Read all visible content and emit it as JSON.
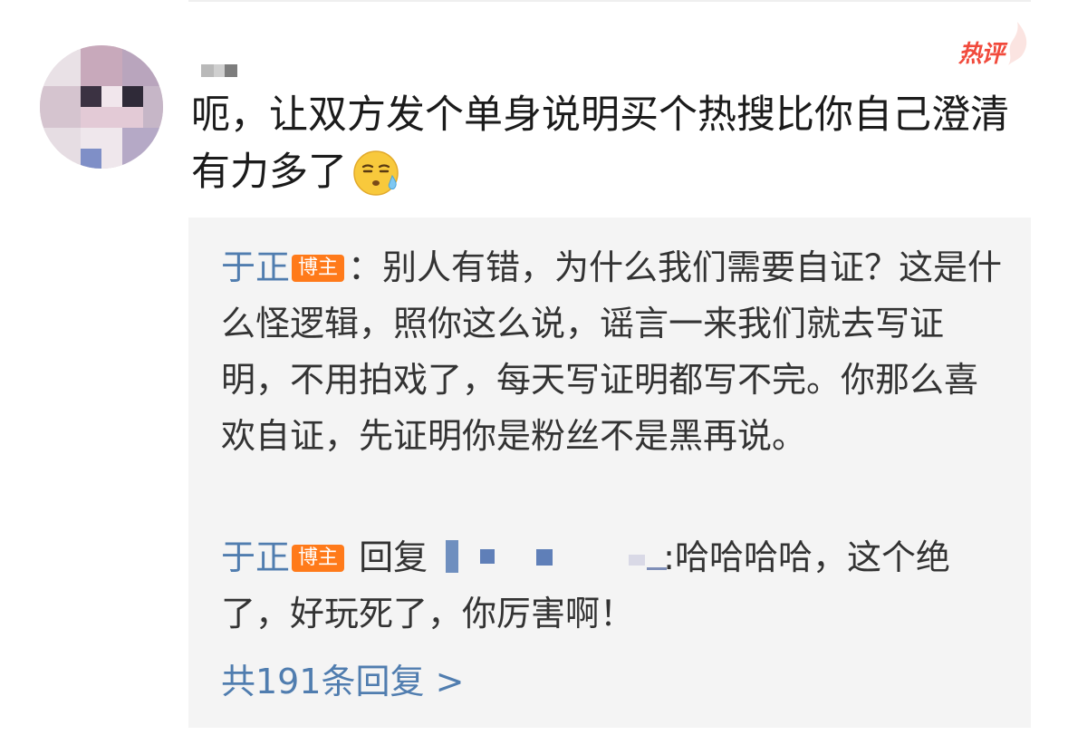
{
  "comment": {
    "text": "呃，让双方发个单身说明买个热搜比你自己澄清有力多了",
    "emoji": "sweat-emoji",
    "hot_label": "热评"
  },
  "replies": [
    {
      "author": "于正",
      "badge": "博主",
      "separator": "：",
      "text": "别人有错，为什么我们需要自证？这是什么怪逻辑，照你这么说，谣言一来我们就去写证明，不用拍戏了，每天写证明都写不完。你那么喜欢自证，先证明你是粉丝不是黑再说。"
    },
    {
      "author": "于正",
      "badge": "博主",
      "reply_word": "回复",
      "separator": ":",
      "text": "哈哈哈哈，这个绝了，好玩死了，你厉害啊！"
    }
  ],
  "more_replies": "共191条回复 >",
  "colors": {
    "link_blue": "#507daf",
    "badge_orange": "#ff7a1a",
    "hot_red": "#f14a3c",
    "reply_bg": "#f4f4f4",
    "text": "#1b1b1b"
  }
}
